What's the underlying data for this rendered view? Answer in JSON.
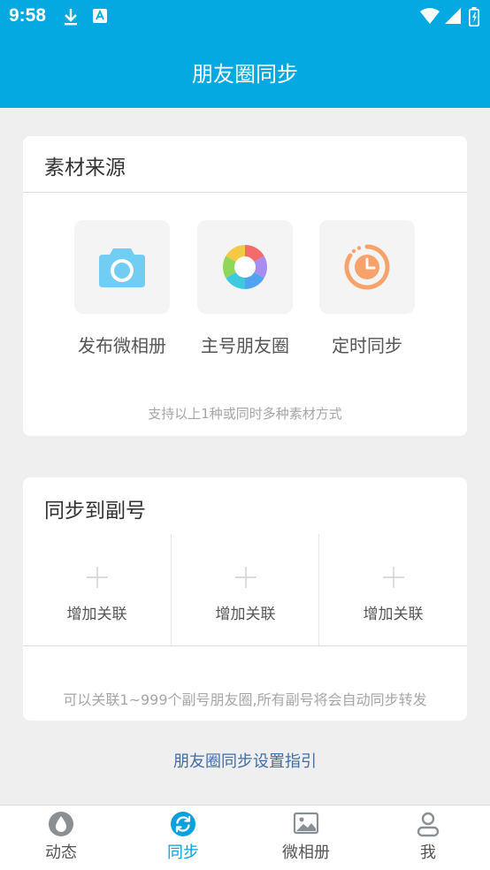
{
  "status_bar": {
    "time": "9:58",
    "icons": [
      "download-icon",
      "a11y-icon",
      "wifi-icon",
      "signal-icon",
      "battery-icon"
    ]
  },
  "header": {
    "title": "朋友圈同步"
  },
  "material_source": {
    "title": "素材来源",
    "items": [
      {
        "label": "发布微相册",
        "icon": "camera-icon"
      },
      {
        "label": "主号朋友圈",
        "icon": "aperture-icon"
      },
      {
        "label": "定时同步",
        "icon": "timer-icon"
      }
    ],
    "tip": "支持以上1种或同时多种素材方式"
  },
  "sync_to_sub": {
    "title": "同步到副号",
    "slots": [
      {
        "label": "增加关联"
      },
      {
        "label": "增加关联"
      },
      {
        "label": "增加关联"
      }
    ],
    "tip": "可以关联1~999个副号朋友圈,所有副号将会自动同步转发"
  },
  "guide_link": "朋友圈同步设置指引",
  "tabs": [
    {
      "label": "动态",
      "icon": "drop-icon",
      "active": false
    },
    {
      "label": "同步",
      "icon": "sync-icon",
      "active": true
    },
    {
      "label": "微相册",
      "icon": "image-icon",
      "active": false
    },
    {
      "label": "我",
      "icon": "person-icon",
      "active": false
    }
  ],
  "colors": {
    "primary": "#03a9e0",
    "background": "#efefef",
    "link": "#3e6ea8",
    "tab_active": "#0aa0e0"
  }
}
